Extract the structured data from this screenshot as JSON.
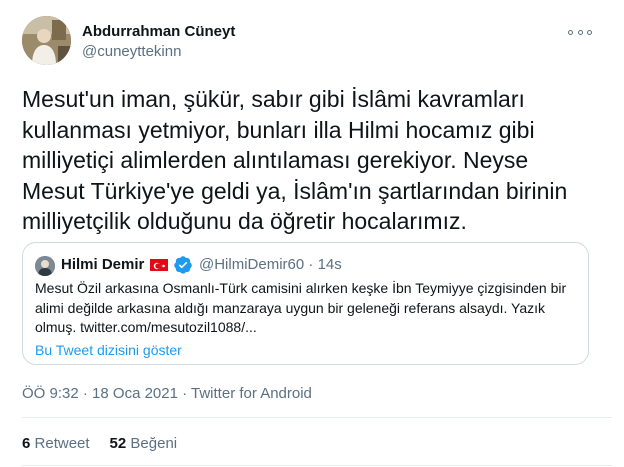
{
  "author": {
    "name": "Abdurrahman Cüneyt",
    "handle": "@cuneyttekinn"
  },
  "tweet_text": "Mesut'un iman, şükür, sabır gibi İslâmi kavramları\nkullanması yetmiyor, bunları illa Hilmi hocamız gibi\nmilliyetiçi alimlerden alıntılaması  gerekiyor. Neyse\nMesut Türkiye'ye geldi ya, İslâm'ın şartlarından birinin\nmilliyetçilik olduğunu da öğretir hocalarımız.",
  "quoted_tweet": {
    "name": "Hilmi Demir",
    "handle_time": "@HilmiDemir60 · 14s",
    "text": "Mesut Özil arkasına Osmanlı-Türk camisini alırken keşke İbn Teymiyye çizgisinden bir alimi değilde arkasına aldığı manzaraya uygun bir geleneği referans alsaydı. Yazık olmuş. twitter.com/mesutozil1088/...",
    "show_thread": "Bu Tweet dizisini göster"
  },
  "meta": {
    "time": "ÖÖ 9:32",
    "separator": " · ",
    "date": "18 Oca 2021",
    "source": "Twitter for Android"
  },
  "stats": {
    "retweets_count": "6",
    "retweets_label": "Retweet",
    "likes_count": "52",
    "likes_label": "Beğeni"
  },
  "icons": {
    "more": "more-icon",
    "verified": "verified-badge-icon",
    "flag": "turkey-flag-icon"
  },
  "colors": {
    "text": "#0f1419",
    "secondary": "#5b7083",
    "link": "#1d9bf0",
    "border": "#cfd9de",
    "flag_red": "#e30a17"
  }
}
